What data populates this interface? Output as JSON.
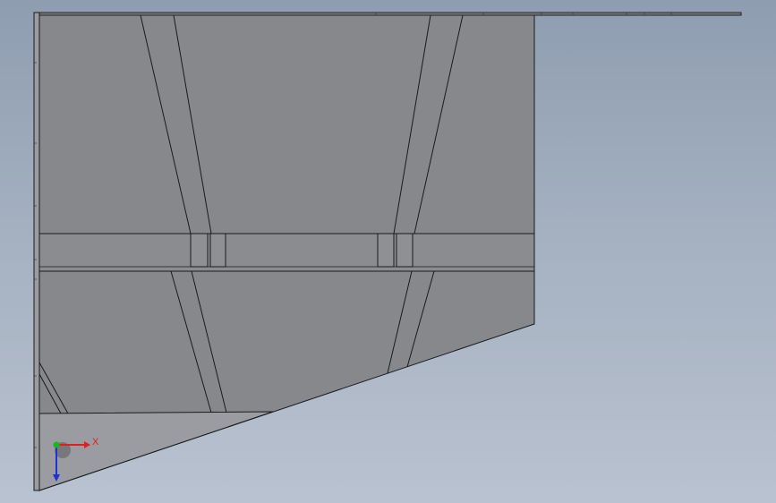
{
  "viewport": {
    "background_top": "#8e9db0",
    "background_bottom": "#b9c2d0",
    "model_face_color": "#86888c",
    "model_edge_color": "#1a1a1a"
  },
  "triad": {
    "x_label": "X",
    "x_color": "#e02020",
    "y_color": "#18b818",
    "z_color": "#2030d8"
  }
}
